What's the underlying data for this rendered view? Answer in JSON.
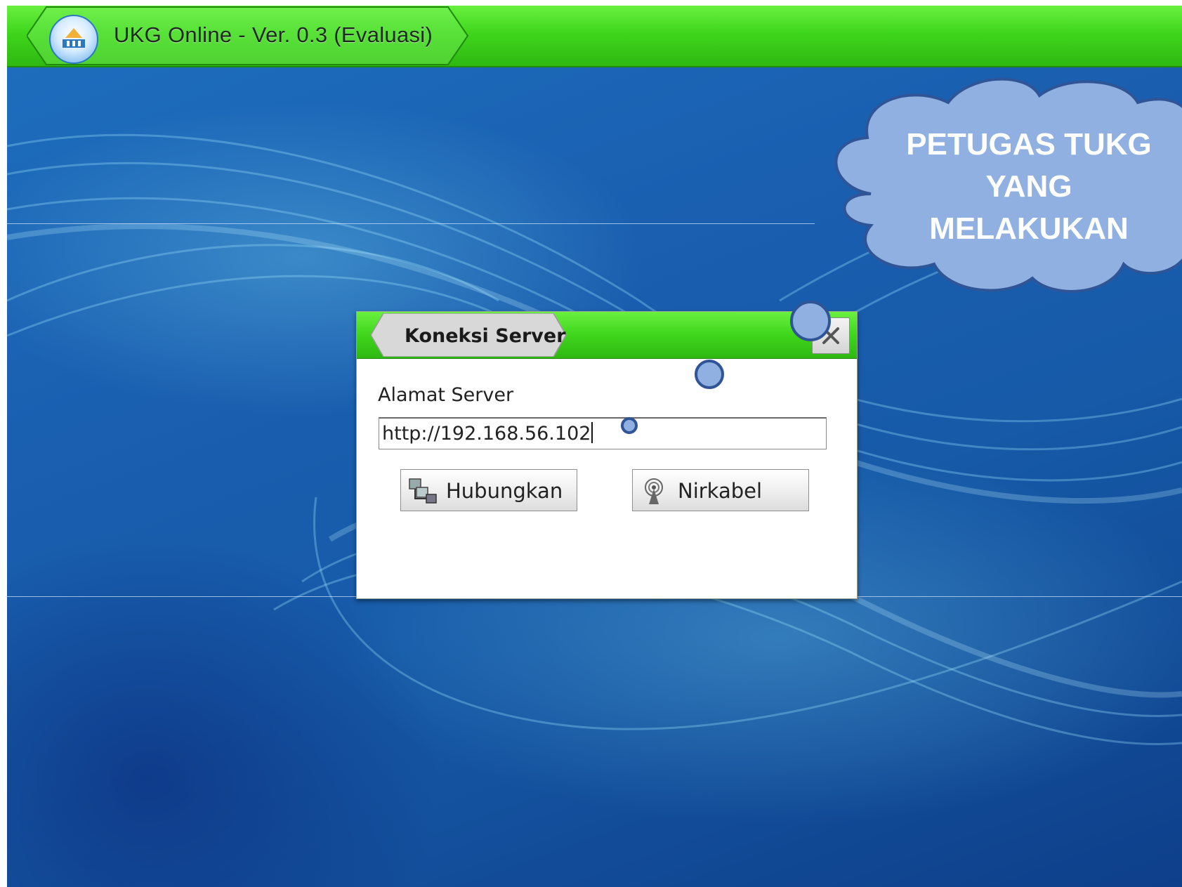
{
  "app": {
    "title": "UKG Online - Ver. 0.3 (Evaluasi)"
  },
  "callout": {
    "lines": [
      "PETUGAS TUKG",
      "YANG",
      "MELAKUKAN"
    ]
  },
  "dialog": {
    "title": "Koneksi Server",
    "field_label": "Alamat Server",
    "server_address": "http://192.168.56.102",
    "buttons": {
      "connect": "Hubungkan",
      "wireless": "Nirkabel"
    }
  },
  "colors": {
    "bar_green": "#3fd61c",
    "background_blue": "#1a5fb0",
    "callout_fill": "#8fb0e0",
    "callout_border": "#2f5597"
  },
  "icons": [
    "app-logo-icon",
    "close-icon",
    "connect-icon",
    "wireless-icon"
  ]
}
